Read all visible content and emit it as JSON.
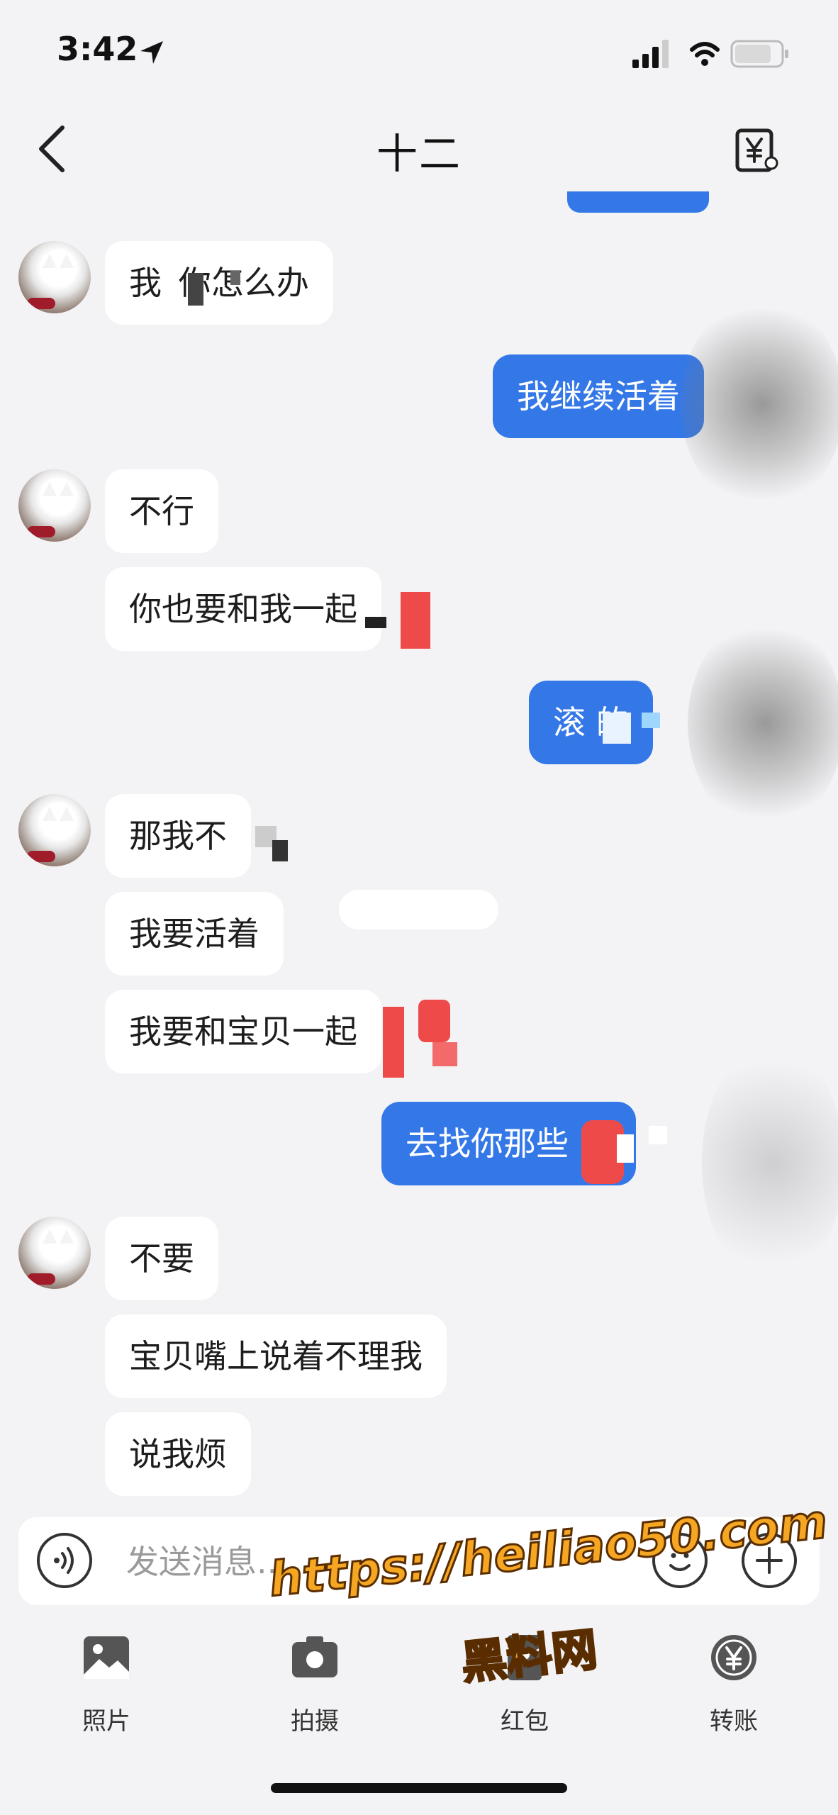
{
  "status_bar": {
    "time": "3:42"
  },
  "nav": {
    "title": "十二"
  },
  "messages": [
    {
      "id": "m1",
      "side": "in",
      "text": "我  你怎么办"
    },
    {
      "id": "m2",
      "side": "out",
      "text": "我继续活着"
    },
    {
      "id": "m3",
      "side": "in",
      "text": "不行"
    },
    {
      "id": "m4",
      "side": "in",
      "text": "你也要和我一起"
    },
    {
      "id": "m5",
      "side": "out",
      "text": "滚    的"
    },
    {
      "id": "m6",
      "side": "in",
      "text": "那我不"
    },
    {
      "id": "m7",
      "side": "in",
      "text": "我要活着"
    },
    {
      "id": "m8",
      "side": "in",
      "text": "我要和宝贝一起"
    },
    {
      "id": "m9",
      "side": "out",
      "text": "去找你那些      吧"
    },
    {
      "id": "m10",
      "side": "in",
      "text": "不要"
    },
    {
      "id": "m11",
      "side": "in",
      "text": "宝贝嘴上说着不理我"
    },
    {
      "id": "m12",
      "side": "in",
      "text": "说我烦"
    }
  ],
  "input": {
    "placeholder": "发送消息..."
  },
  "toolbar": {
    "photo": "照片",
    "camera": "拍摄",
    "red_packet": "红包",
    "transfer": "转账"
  },
  "watermark": {
    "url": "https://heiliao50.com",
    "name": "黑料网"
  },
  "colors": {
    "outgoing_bubble": "#3478e8",
    "incoming_bubble": "#ffffff",
    "background": "#f3f3f5",
    "watermark": "#f5a623"
  }
}
